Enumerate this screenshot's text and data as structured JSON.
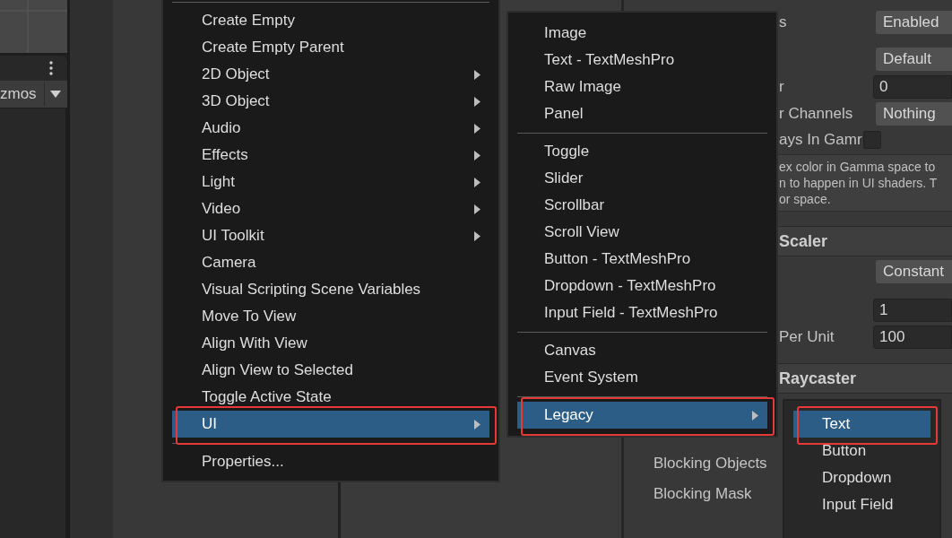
{
  "scene_panel": {
    "toolbar_label": "zmos"
  },
  "inspector": {
    "rows": [
      {
        "kind": "dropdown",
        "label": "s",
        "value": "Enabled"
      },
      {
        "kind": "dropdown",
        "value": "Default"
      },
      {
        "kind": "number",
        "label": "r",
        "value": "0"
      },
      {
        "kind": "dropdown",
        "label": "r Channels",
        "value": "Nothing"
      },
      {
        "kind": "checkbox",
        "label": "ays In Gamr",
        "checked": false
      },
      {
        "kind": "help",
        "lines": [
          "ex color in Gamma space to",
          "n to happen in UI shaders. T",
          "or space."
        ]
      },
      {
        "kind": "header",
        "label": "Scaler"
      },
      {
        "kind": "dropdown",
        "value": "Constant"
      },
      {
        "kind": "number",
        "value": "1"
      },
      {
        "kind": "number",
        "label": "Per Unit",
        "value": "100"
      },
      {
        "kind": "header",
        "label": "Raycaster"
      },
      {
        "kind": "label",
        "label": "Blocking Objects"
      },
      {
        "kind": "label",
        "label": "Blocking Mask"
      }
    ]
  },
  "context_menu": {
    "items": [
      {
        "kind": "item",
        "label": "Create Empty",
        "submenu": false,
        "selected": false,
        "annotated": false
      },
      {
        "kind": "item",
        "label": "Create Empty Parent",
        "submenu": false,
        "selected": false,
        "annotated": false
      },
      {
        "kind": "item",
        "label": "2D Object",
        "submenu": true,
        "selected": false,
        "annotated": false
      },
      {
        "kind": "item",
        "label": "3D Object",
        "submenu": true,
        "selected": false,
        "annotated": false
      },
      {
        "kind": "item",
        "label": "Audio",
        "submenu": true,
        "selected": false,
        "annotated": false
      },
      {
        "kind": "item",
        "label": "Effects",
        "submenu": true,
        "selected": false,
        "annotated": false
      },
      {
        "kind": "item",
        "label": "Light",
        "submenu": true,
        "selected": false,
        "annotated": false
      },
      {
        "kind": "item",
        "label": "Video",
        "submenu": true,
        "selected": false,
        "annotated": false
      },
      {
        "kind": "item",
        "label": "UI Toolkit",
        "submenu": true,
        "selected": false,
        "annotated": false
      },
      {
        "kind": "item",
        "label": "Camera",
        "submenu": false,
        "selected": false,
        "annotated": false
      },
      {
        "kind": "item",
        "label": "Visual Scripting Scene Variables",
        "submenu": false,
        "selected": false,
        "annotated": false
      },
      {
        "kind": "item",
        "label": "Move To View",
        "submenu": false,
        "selected": false,
        "annotated": false
      },
      {
        "kind": "item",
        "label": "Align With View",
        "submenu": false,
        "selected": false,
        "annotated": false
      },
      {
        "kind": "item",
        "label": "Align View to Selected",
        "submenu": false,
        "selected": false,
        "annotated": false
      },
      {
        "kind": "item",
        "label": "Toggle Active State",
        "submenu": false,
        "selected": false,
        "annotated": false
      },
      {
        "kind": "item",
        "label": "UI",
        "submenu": true,
        "selected": true,
        "annotated": true
      },
      {
        "kind": "separator"
      },
      {
        "kind": "item",
        "label": "Properties...",
        "submenu": false,
        "selected": false,
        "annotated": false
      }
    ]
  },
  "ui_submenu": {
    "items": [
      {
        "kind": "item",
        "label": "Image",
        "submenu": false,
        "selected": false,
        "annotated": false
      },
      {
        "kind": "item",
        "label": "Text - TextMeshPro",
        "submenu": false,
        "selected": false,
        "annotated": false
      },
      {
        "kind": "item",
        "label": "Raw Image",
        "submenu": false,
        "selected": false,
        "annotated": false
      },
      {
        "kind": "item",
        "label": "Panel",
        "submenu": false,
        "selected": false,
        "annotated": false
      },
      {
        "kind": "separator"
      },
      {
        "kind": "item",
        "label": "Toggle",
        "submenu": false,
        "selected": false,
        "annotated": false
      },
      {
        "kind": "item",
        "label": "Slider",
        "submenu": false,
        "selected": false,
        "annotated": false
      },
      {
        "kind": "item",
        "label": "Scrollbar",
        "submenu": false,
        "selected": false,
        "annotated": false
      },
      {
        "kind": "item",
        "label": "Scroll View",
        "submenu": false,
        "selected": false,
        "annotated": false
      },
      {
        "kind": "item",
        "label": "Button - TextMeshPro",
        "submenu": false,
        "selected": false,
        "annotated": false
      },
      {
        "kind": "item",
        "label": "Dropdown - TextMeshPro",
        "submenu": false,
        "selected": false,
        "annotated": false
      },
      {
        "kind": "item",
        "label": "Input Field - TextMeshPro",
        "submenu": false,
        "selected": false,
        "annotated": false
      },
      {
        "kind": "separator"
      },
      {
        "kind": "item",
        "label": "Canvas",
        "submenu": false,
        "selected": false,
        "annotated": false
      },
      {
        "kind": "item",
        "label": "Event System",
        "submenu": false,
        "selected": false,
        "annotated": false
      },
      {
        "kind": "separator"
      },
      {
        "kind": "item",
        "label": "Legacy",
        "submenu": true,
        "selected": true,
        "annotated": true
      }
    ]
  },
  "legacy_submenu": {
    "items": [
      {
        "kind": "item",
        "label": "Text",
        "submenu": false,
        "selected": true,
        "annotated": true
      },
      {
        "kind": "item",
        "label": "Button",
        "submenu": false,
        "selected": false,
        "annotated": false
      },
      {
        "kind": "item",
        "label": "Dropdown",
        "submenu": false,
        "selected": false,
        "annotated": false
      },
      {
        "kind": "item",
        "label": "Input Field",
        "submenu": false,
        "selected": false,
        "annotated": false
      }
    ]
  }
}
